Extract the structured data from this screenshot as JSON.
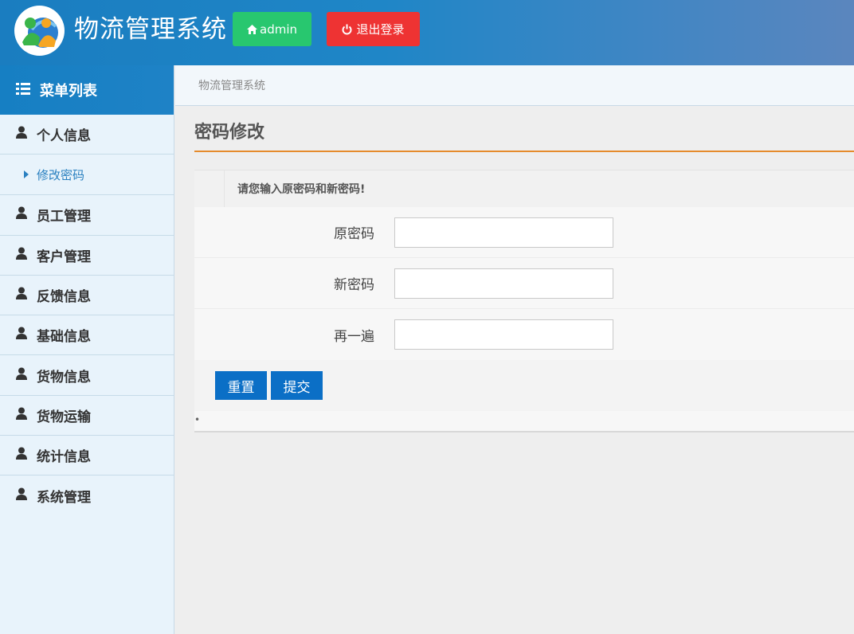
{
  "header": {
    "title": "物流管理系统",
    "admin_label": "admin",
    "logout_label": "退出登录"
  },
  "sidebar": {
    "head_label": "菜单列表",
    "items": [
      {
        "label": "个人信息",
        "icon": "user-icon"
      },
      {
        "label": "修改密码",
        "icon": "caret-right-icon",
        "sub": true
      },
      {
        "label": "员工管理",
        "icon": "user-icon"
      },
      {
        "label": "客户管理",
        "icon": "user-icon"
      },
      {
        "label": "反馈信息",
        "icon": "user-icon"
      },
      {
        "label": "基础信息",
        "icon": "user-icon"
      },
      {
        "label": "货物信息",
        "icon": "user-icon"
      },
      {
        "label": "货物运输",
        "icon": "user-icon"
      },
      {
        "label": "统计信息",
        "icon": "user-icon"
      },
      {
        "label": "系统管理",
        "icon": "user-icon"
      }
    ]
  },
  "breadcrumb": "物流管理系统",
  "page": {
    "title": "密码修改",
    "tip": "请您输入原密码和新密码!",
    "tip_icon": "",
    "fields": [
      {
        "label": "原密码",
        "value": ""
      },
      {
        "label": "新密码",
        "value": ""
      },
      {
        "label": "再一遍",
        "value": ""
      }
    ],
    "reset_label": "重置",
    "submit_label": "提交",
    "bullet": "•"
  },
  "colors": {
    "header_bg": "#1a7dc0",
    "admin_btn": "#28c76f",
    "logout_btn": "#ee3333",
    "primary_btn": "#0b6fc6",
    "title_rule": "#e58b2c"
  }
}
